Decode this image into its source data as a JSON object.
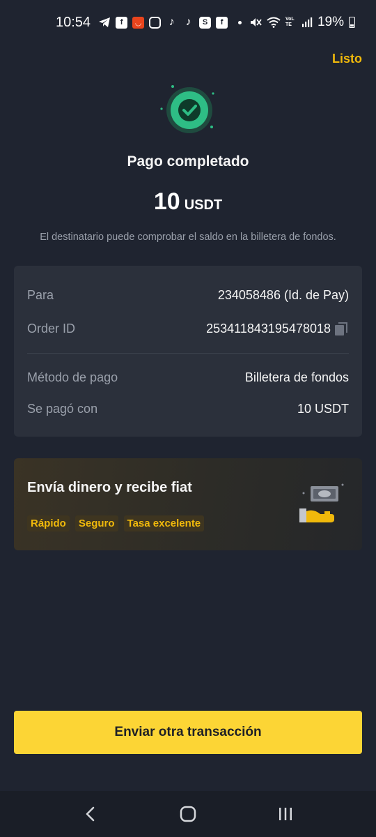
{
  "status_bar": {
    "time": "10:54",
    "battery": "19%",
    "network": "VoLTE"
  },
  "header": {
    "done_label": "Listo"
  },
  "result": {
    "title": "Pago completado",
    "amount_value": "10",
    "amount_unit": "USDT",
    "subtitle": "El destinatario puede comprobar el saldo en la billetera de fondos."
  },
  "details": {
    "to_label": "Para",
    "to_value": "234058486 (Id. de Pay)",
    "order_label": "Order ID",
    "order_value": "253411843195478018",
    "method_label": "Método de pago",
    "method_value": "Billetera de fondos",
    "paid_label": "Se pagó con",
    "paid_value": "10 USDT"
  },
  "promo": {
    "title": "Envía dinero y recibe fiat",
    "tags": [
      "Rápido",
      "Seguro",
      "Tasa excelente"
    ]
  },
  "primary_action": {
    "label": "Enviar otra transacción"
  },
  "colors": {
    "background": "#1f2430",
    "card": "#2b303b",
    "accent": "#f0b90b",
    "button": "#fcd535",
    "success": "#2ebd85"
  },
  "icons": [
    "telegram-icon",
    "facebook-icon",
    "aliexpress-icon",
    "instagram-icon",
    "tiktok-icon",
    "skype-icon",
    "mute-icon",
    "wifi-icon",
    "signal-icon",
    "battery-icon",
    "check-circle-icon",
    "copy-icon",
    "money-hand-icon",
    "back-icon",
    "home-icon",
    "recents-icon"
  ]
}
